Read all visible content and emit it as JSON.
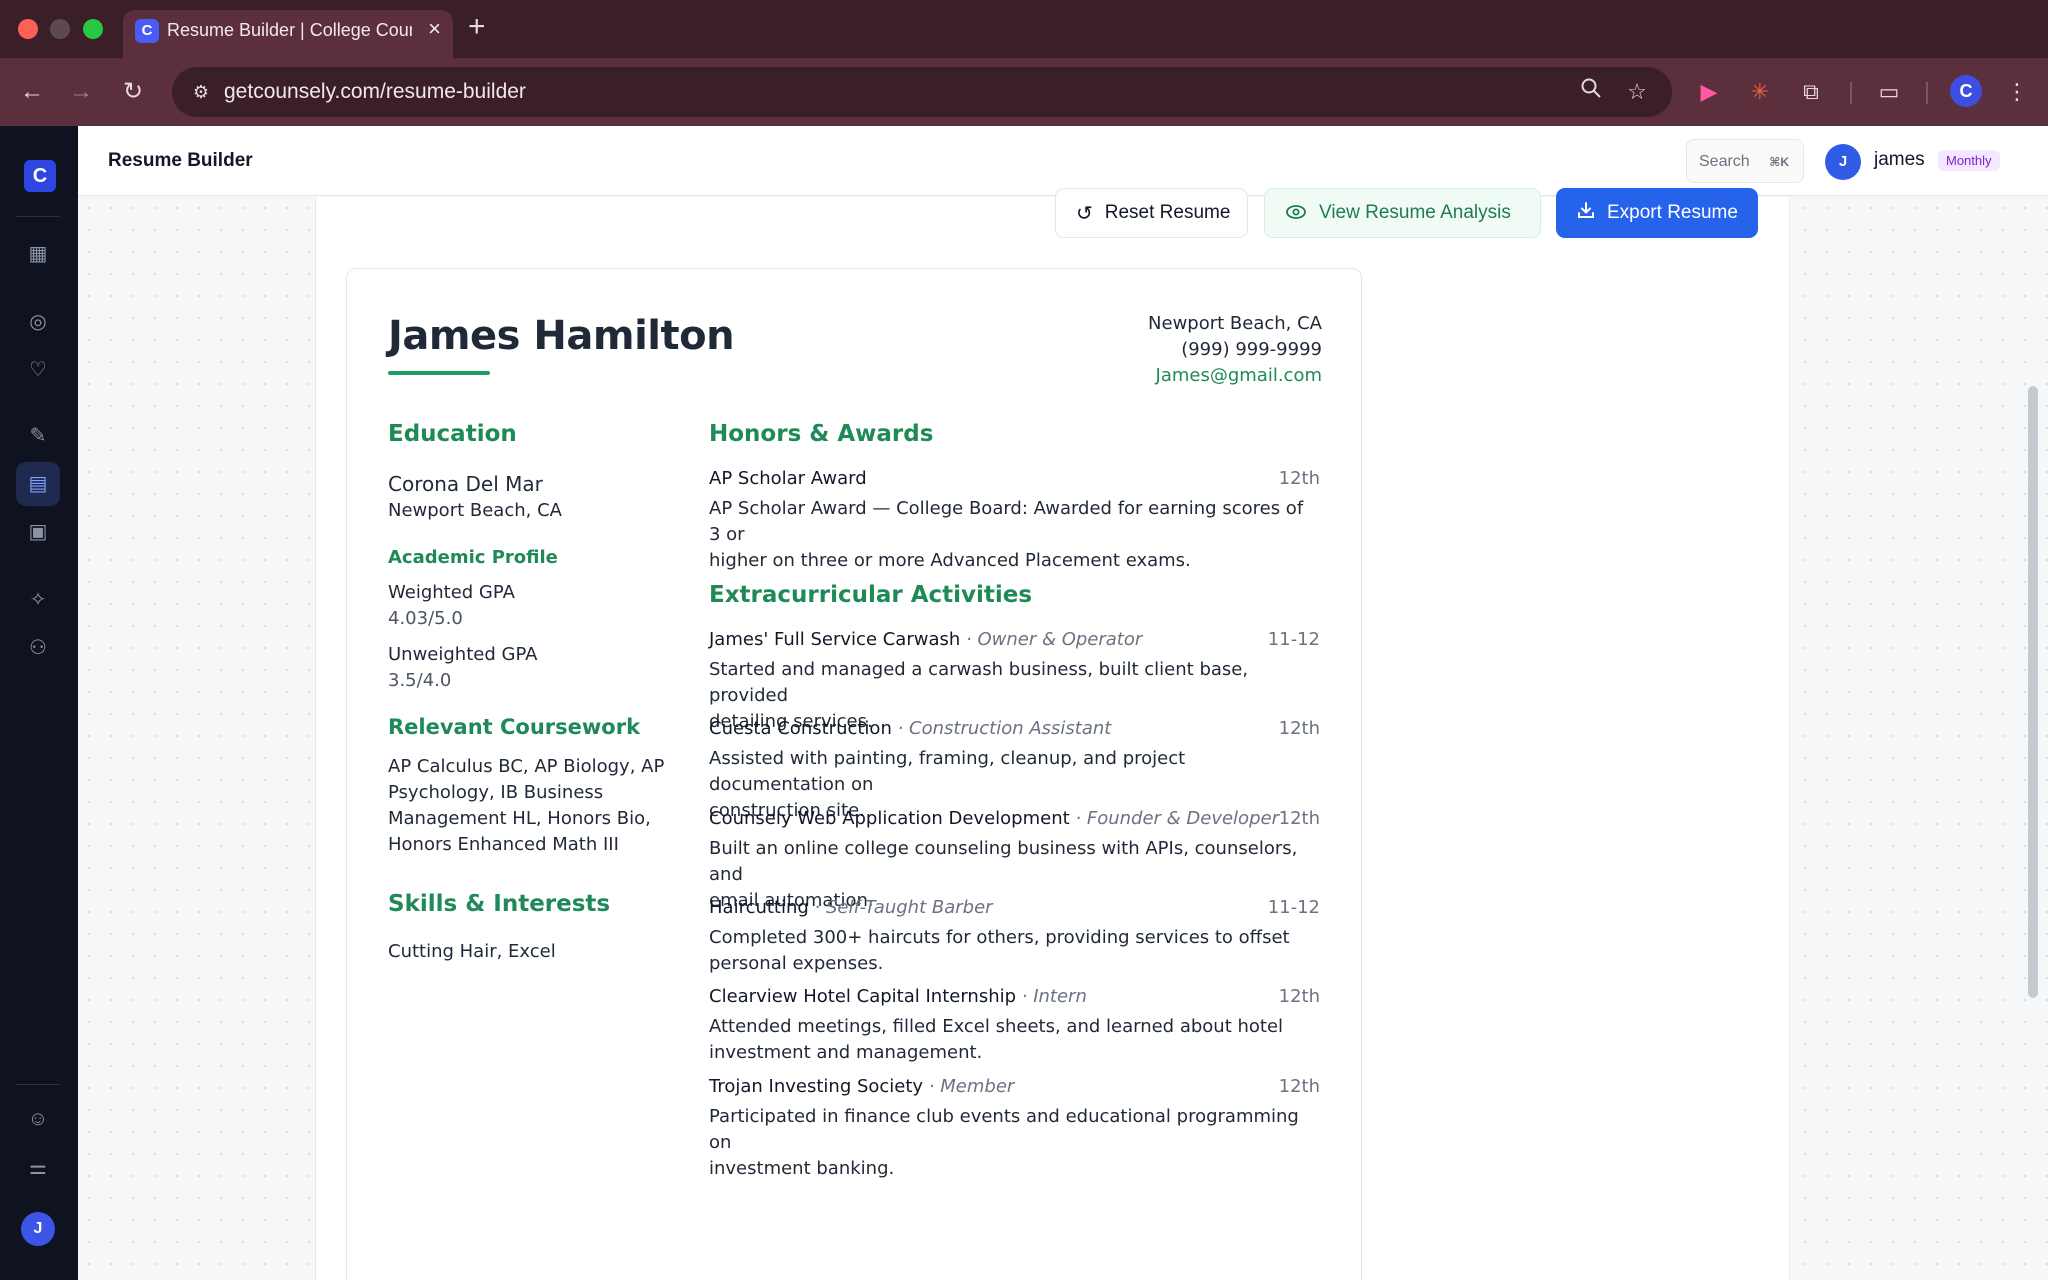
{
  "browser": {
    "tab_title": "Resume Builder | College Counsely",
    "url": "getcounsely.com/resume-builder"
  },
  "header": {
    "page_title": "Resume Builder",
    "search_label": "Search",
    "search_shortcut": "⌘K",
    "user_initial": "J",
    "user_name": "james",
    "plan": "Monthly"
  },
  "sidebar": {
    "logo": "C",
    "items": [
      {
        "name": "dashboard",
        "icon": "grid-icon"
      },
      {
        "name": "explore",
        "icon": "compass-icon"
      },
      {
        "name": "favorites",
        "icon": "heart-icon"
      },
      {
        "name": "essays",
        "icon": "pen-icon"
      },
      {
        "name": "resume",
        "icon": "document-icon",
        "active": true
      },
      {
        "name": "calendar",
        "icon": "calendar-icon"
      },
      {
        "name": "ai",
        "icon": "sparkle-icon"
      },
      {
        "name": "counselors",
        "icon": "users-icon"
      },
      {
        "name": "account",
        "icon": "user-circle-icon"
      },
      {
        "name": "settings",
        "icon": "sliders-icon"
      }
    ],
    "avatar_initial": "J"
  },
  "actions": {
    "reset": "Reset Resume",
    "analysis": "View Resume Analysis",
    "export": "Export Resume"
  },
  "resume": {
    "name": "James Hamilton",
    "contact": {
      "location": "Newport Beach, CA",
      "phone": "(999) 999-9999",
      "email": "James@gmail.com"
    },
    "education": {
      "heading": "Education",
      "school": "Corona Del Mar",
      "school_location": "Newport Beach, CA",
      "academic_profile_heading": "Academic Profile",
      "weighted_label": "Weighted GPA",
      "weighted_value": "4.03/5.0",
      "unweighted_label": "Unweighted GPA",
      "unweighted_value": "3.5/4.0"
    },
    "coursework": {
      "heading": "Relevant Coursework",
      "lines": [
        "AP Calculus BC, AP Biology, AP",
        "Psychology, IB Business",
        "Management HL, Honors Bio,",
        "Honors Enhanced Math III"
      ]
    },
    "skills": {
      "heading": "Skills & Interests",
      "text": "Cutting Hair, Excel"
    },
    "honors": {
      "heading": "Honors & Awards",
      "items": [
        {
          "title": "AP Scholar Award",
          "date": "12th",
          "desc_lines": [
            "AP Scholar Award — College Board: Awarded for earning scores of 3 or",
            "higher on three or more Advanced Placement exams."
          ]
        }
      ]
    },
    "activities": {
      "heading": "Extracurricular Activities",
      "items": [
        {
          "title": "James' Full Service Carwash",
          "role": " · Owner & Operator",
          "date": "11-12",
          "desc_lines": [
            "Started and managed a carwash business, built client base, provided",
            "detailing services."
          ]
        },
        {
          "title": "Cuesta Construction",
          "role": " · Construction Assistant",
          "date": "12th",
          "desc_lines": [
            "Assisted with painting, framing, cleanup, and project documentation on",
            "construction site."
          ]
        },
        {
          "title": "Counsely Web Application Development",
          "role": " · Founder & Developer",
          "date": "12th",
          "desc_lines": [
            "Built an online college counseling business with APIs, counselors, and",
            "email automation."
          ]
        },
        {
          "title": "Haircutting",
          "role": " · Self-Taught Barber",
          "date": "11-12",
          "desc_lines": [
            "Completed 300+ haircuts for others, providing services to offset",
            "personal expenses."
          ]
        },
        {
          "title": "Clearview Hotel Capital Internship",
          "role": " · Intern",
          "date": "12th",
          "desc_lines": [
            "Attended meetings, filled Excel sheets, and learned about hotel",
            "investment and management."
          ]
        },
        {
          "title": "Trojan Investing Society",
          "role": " · Member",
          "date": "12th",
          "desc_lines": [
            "Participated in finance club events and educational programming on",
            "investment banking."
          ]
        }
      ]
    }
  }
}
